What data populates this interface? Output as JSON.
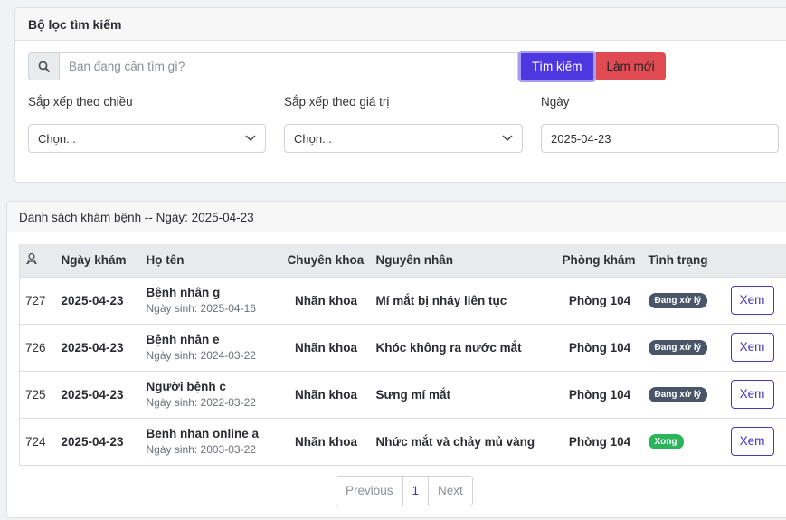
{
  "filter": {
    "title": "Bộ lọc tìm kiếm",
    "search_placeholder": "Bạn đang cần tìm gì?",
    "search_button": "Tìm kiếm",
    "reset_button": "Làm mới",
    "sort_direction": {
      "label": "Sắp xếp theo chiều",
      "value": "Chọn..."
    },
    "sort_value": {
      "label": "Sắp xếp theo giá trị",
      "value": "Chọn..."
    },
    "date": {
      "label": "Ngày",
      "value": "2025-04-23"
    }
  },
  "list": {
    "title": "Danh sách khám bệnh -- Ngày: 2025-04-23",
    "columns": [
      "Ngày khám",
      "Họ tên",
      "Chuyên khoa",
      "Nguyên nhân",
      "Phòng khám",
      "Tình trạng"
    ],
    "rows": [
      {
        "id": "727",
        "date": "2025-04-23",
        "name": "Bệnh nhân g",
        "dob": "Ngày sinh: 2025-04-16",
        "specialty": "Nhãn khoa",
        "reason": "Mí mắt bị nháy liên tục",
        "room": "Phòng 104",
        "status": "Đang xử lý",
        "action": "Xem"
      },
      {
        "id": "726",
        "date": "2025-04-23",
        "name": "Bệnh nhân e",
        "dob": "Ngày sinh: 2024-03-22",
        "specialty": "Nhãn khoa",
        "reason": "Khóc không ra nước mắt",
        "room": "Phòng 104",
        "status": "Đang xử lý",
        "action": "Xem"
      },
      {
        "id": "725",
        "date": "2025-04-23",
        "name": "Người bệnh c",
        "dob": "Ngày sinh: 2022-03-22",
        "specialty": "Nhãn khoa",
        "reason": "Sưng mí mắt",
        "room": "Phòng 104",
        "status": "Đang xử lý",
        "action": "Xem"
      },
      {
        "id": "724",
        "date": "2025-04-23",
        "name": "Benh nhan online a",
        "dob": "Ngày sinh: 2003-03-22",
        "specialty": "Nhãn khoa",
        "reason": "Nhức mắt và chảy mủ vàng",
        "room": "Phòng 104",
        "status": "Xong",
        "action": "Xem"
      }
    ],
    "pagination": {
      "previous": "Previous",
      "page": "1",
      "next": "Next"
    }
  },
  "colors": {
    "status_processing": "#4a5568",
    "status_done": "#2ab55a",
    "primary": "#4d37e0",
    "danger": "#e04a52"
  },
  "icons": {
    "search": "search-icon",
    "id_column": "users-icon",
    "select_chevron": "chevron-down-icon"
  }
}
